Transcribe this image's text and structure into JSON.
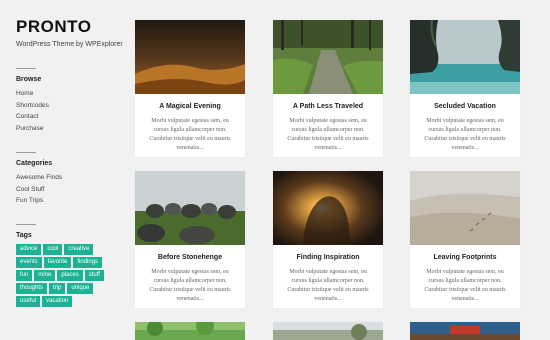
{
  "site": {
    "logo": "PRONTO",
    "tagline": "WordPress Theme by WPExplorer"
  },
  "sidebar": {
    "browse": {
      "heading": "Browse",
      "items": [
        "Home",
        "Shortcodes",
        "Contact",
        "Purchase"
      ]
    },
    "categories": {
      "heading": "Categories",
      "items": [
        "Awesome Finds",
        "Cool Stuff",
        "Fun Trips"
      ]
    },
    "tags": {
      "heading": "Tags",
      "items": [
        "advice",
        "cool",
        "creative",
        "events",
        "favorite",
        "findings",
        "fun",
        "mine",
        "places",
        "stuff",
        "thoughts",
        "trip",
        "unique",
        "useful",
        "vacation"
      ]
    }
  },
  "posts": [
    {
      "title": "A Magical Evening",
      "excerpt": "Morbi vulputate egestas sem, eu cursus ligula ullamcorper non. Curabitur tristique velit eu mauris venenatis..."
    },
    {
      "title": "A Path Less Traveled",
      "excerpt": "Morbi vulputate egestas sem, eu cursus ligula ullamcorper non. Curabitur tristique velit eu mauris venenatis..."
    },
    {
      "title": "Secluded Vacation",
      "excerpt": "Morbi vulputate egestas sem, eu cursus ligula ullamcorper non. Curabitur tristique velit eu mauris venenatis..."
    },
    {
      "title": "Before Stonehenge",
      "excerpt": "Morbi vulputate egestas sem, eu cursus ligula ullamcorper non. Curabitur tristique velit eu mauris venenatis..."
    },
    {
      "title": "Finding Inspiration",
      "excerpt": "Morbi vulputate egestas sem, eu cursus ligula ullamcorper non. Curabitur tristique velit eu mauris venenatis..."
    },
    {
      "title": "Leaving Footprints",
      "excerpt": "Morbi vulputate egestas sem, eu cursus ligula ullamcorper non. Curabitur tristique velit eu mauris venenatis..."
    }
  ],
  "colors": {
    "accent": "#1bb394",
    "background": "#f1f1f1"
  }
}
